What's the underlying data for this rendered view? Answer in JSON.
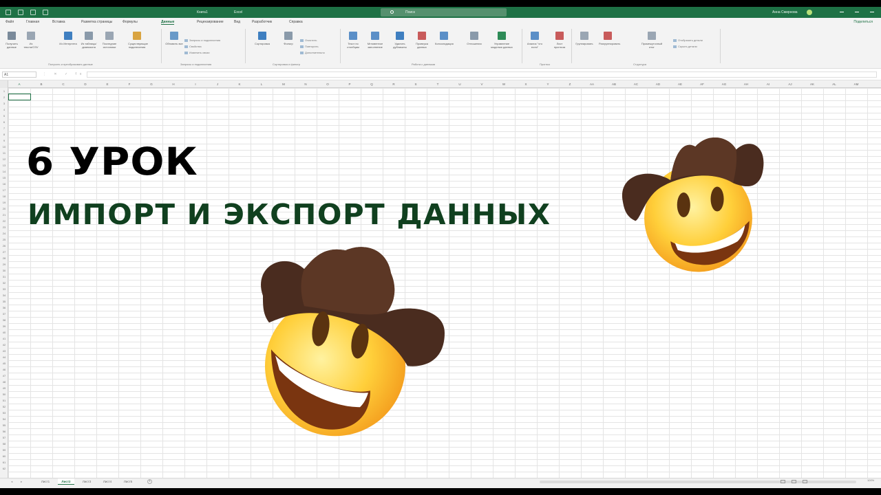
{
  "titlebar": {
    "doc_title": "Книга1",
    "app_name": "Excel",
    "search_label": "Поиск",
    "account": "Анна Смирнова"
  },
  "tabs": [
    "Файл",
    "Главная",
    "Вставка",
    "Разметка страницы",
    "Формулы",
    "Данные",
    "Рецензирование",
    "Вид",
    "Разработчик",
    "Справка"
  ],
  "active_tab": "Данные",
  "share_label": "Поделиться",
  "ribbon": {
    "buttons": [
      {
        "label": "Получить данные",
        "color": "#7a8a9a"
      },
      {
        "label": "Из текста/CSV",
        "color": "#9aa6b3"
      },
      {
        "label": "Из Интернета",
        "color": "#3f7fc0"
      },
      {
        "label": "Из таблицы/диапазона",
        "color": "#8a9aaa"
      },
      {
        "label": "Последние источники",
        "color": "#9aa6b3"
      },
      {
        "label": "Существующие подключения",
        "color": "#d9a441"
      },
      {
        "label": "Обновить все",
        "color": "#6a9ac8"
      },
      {
        "label": "Сортировка",
        "color": "#3f7fc0"
      },
      {
        "label": "Фильтр",
        "color": "#8a9aaa"
      },
      {
        "label": "Текст по столбцам",
        "color": "#5b8fc7"
      },
      {
        "label": "Мгновенное заполнение",
        "color": "#5b8fc7"
      },
      {
        "label": "Удалить дубликаты",
        "color": "#3f7fc0"
      },
      {
        "label": "Проверка данных",
        "color": "#c85b5b"
      },
      {
        "label": "Консолидация",
        "color": "#5b8fc7"
      },
      {
        "label": "Отношения",
        "color": "#8a9aaa"
      },
      {
        "label": "Управление моделью данных",
        "color": "#2e8b57"
      },
      {
        "label": "Анализ \"что если\"",
        "color": "#5b8fc7"
      },
      {
        "label": "Лист прогноза",
        "color": "#c85b5b"
      },
      {
        "label": "Группировать",
        "color": "#9aa6b3"
      },
      {
        "label": "Разгруппировать",
        "color": "#c85b5b"
      },
      {
        "label": "Промежуточный итог",
        "color": "#9aa6b3"
      }
    ],
    "small_items": [
      "Запросы и подключения",
      "Свойства",
      "Изменить связи",
      "Очистить",
      "Повторить",
      "Дополнительно",
      "Отобразить детали",
      "Скрыть детали"
    ],
    "groups": [
      "Получить и преобразовать данные",
      "Запросы и подключения",
      "Сортировка и фильтр",
      "Работа с данными",
      "Прогноз",
      "Структура"
    ]
  },
  "formula_bar": {
    "name_box": "A1",
    "fx_icons": "⋮ ✕ ✓ fx"
  },
  "columns": [
    "A",
    "B",
    "C",
    "D",
    "E",
    "F",
    "G",
    "H",
    "I",
    "J",
    "K",
    "L",
    "M",
    "N",
    "O",
    "P",
    "Q",
    "R",
    "S",
    "T",
    "U",
    "V",
    "W",
    "X",
    "Y",
    "Z",
    "AA",
    "AB",
    "AC",
    "AD",
    "AE",
    "AF",
    "AG",
    "AH",
    "AI",
    "AJ",
    "AK",
    "AL",
    "AM"
  ],
  "rows": 62,
  "sheets": [
    "Лист1",
    "Лист2",
    "Лист3",
    "Лист4",
    "Лист5"
  ],
  "active_sheet": "Лист2",
  "zoom": "100%",
  "overlay": {
    "title": "6 УРОК",
    "subtitle": "ИМПОРТ И ЭКСПОРТ ДАННЫХ"
  },
  "colors": {
    "excel_green": "#1e7145",
    "subtitle_green": "#10401f",
    "title_black": "#000000"
  },
  "emojis": [
    "cowboy-hat-face",
    "cowboy-hat-face"
  ]
}
